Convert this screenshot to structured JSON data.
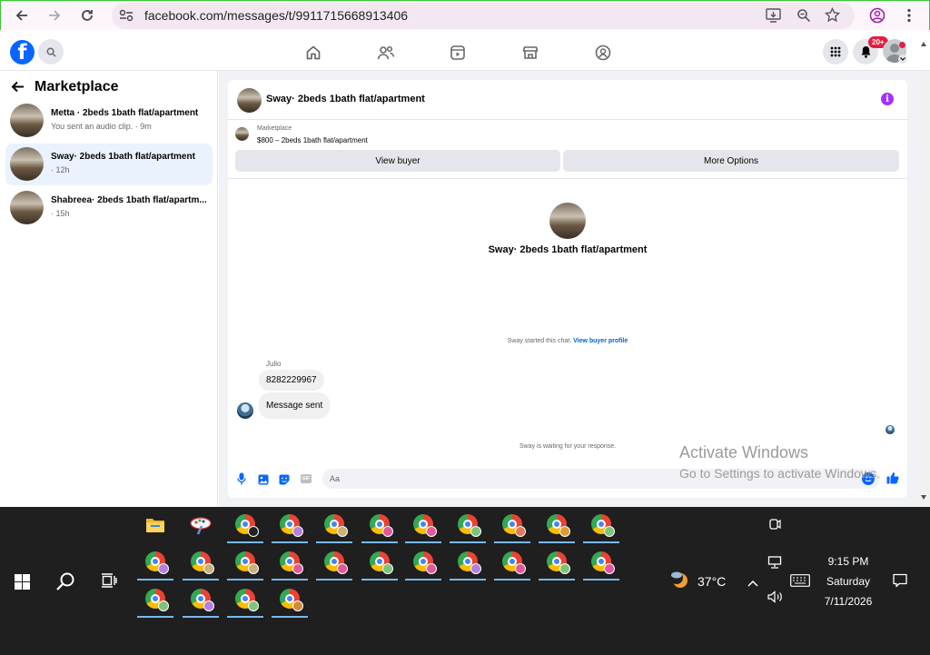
{
  "browser": {
    "url": "facebook.com/messages/t/9911715668913406",
    "icons": [
      "back-arrow-icon",
      "forward-arrow-icon",
      "reload-icon",
      "site-info-icon",
      "install-app-icon",
      "zoom-icon",
      "bookmark-star-icon",
      "profile-icon",
      "menu-icon"
    ]
  },
  "fb": {
    "notification_badge": "20+",
    "colors": {
      "brand": "#0866ff",
      "badge": "#e41e3f",
      "accent_purple": "#a033ff"
    }
  },
  "sidebar": {
    "title": "Marketplace",
    "threads": [
      {
        "name": "Metta · 2beds 1bath flat/apartment",
        "subtitle": "You sent an audio clip. · 9m"
      },
      {
        "name": "Sway· 2beds 1bath flat/apartment",
        "subtitle": "· 12h"
      },
      {
        "name": "Shabreea· 2beds 1bath flat/apartm...",
        "subtitle": "· 15h"
      }
    ]
  },
  "chat": {
    "header_title": "Sway· 2beds 1bath flat/apartment",
    "listing_label": "Marketplace",
    "listing_price": "$800 – 2beds 1bath flat/apartment",
    "view_buyer_label": "View buyer",
    "more_options_label": "More Options",
    "center_name": "Sway· 2beds 1bath flat/apartment",
    "started_text": "Sway started this chat.",
    "view_profile_link": "View buyer profile",
    "sender_name": "Julio",
    "messages": [
      "8282229967",
      "Message sent"
    ],
    "waiting_text": "Sway is waiting for your response.",
    "composer_placeholder": "Aa"
  },
  "watermark": {
    "line1": "Activate Windows",
    "line2": "Go to Settings to activate Windows."
  },
  "taskbar": {
    "temperature": "37°C",
    "time": "9:15 PM",
    "day": "Saturday",
    "date": "7/11/2026"
  }
}
